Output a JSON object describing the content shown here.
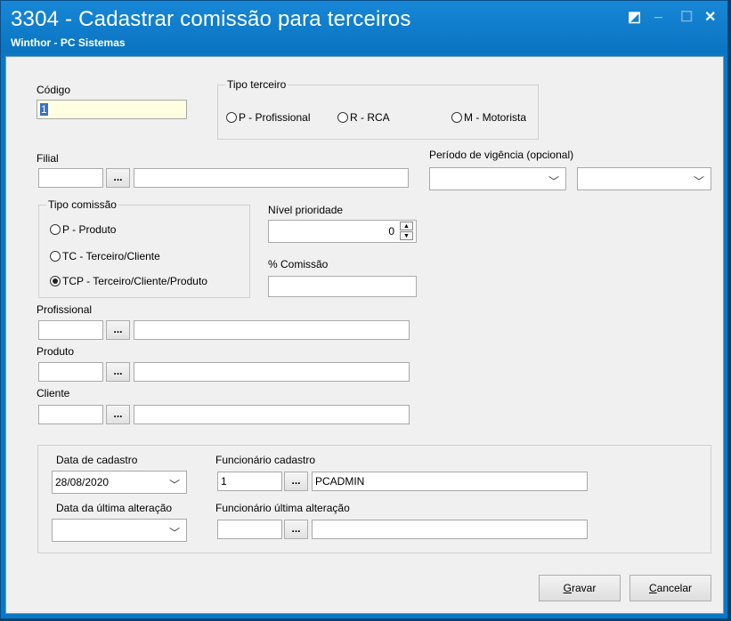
{
  "window": {
    "title": "3304 - Cadastrar comissão para terceiros",
    "subtitle": "Winthor - PC Sistemas",
    "controls": {
      "restore": "◩",
      "minimize": "_",
      "maximize": "☐",
      "close": "✕"
    }
  },
  "codigo": {
    "label": "Código",
    "value": "1"
  },
  "tipo_terceiro": {
    "title": "Tipo terceiro",
    "options": [
      "P - Profissional",
      "R - RCA",
      "M - Motorista"
    ]
  },
  "filial": {
    "label": "Filial",
    "code": "",
    "name": "",
    "button": "..."
  },
  "periodo": {
    "label": "Período de vigência (opcional)",
    "start": "",
    "end": ""
  },
  "tipo_comissao": {
    "title": "Tipo comissão",
    "options": [
      "P - Produto",
      "TC - Terceiro/Cliente",
      "TCP - Terceiro/Cliente/Produto"
    ],
    "selected": "TCP - Terceiro/Cliente/Produto"
  },
  "nivel_prioridade": {
    "label": "Nível prioridade",
    "value": "0"
  },
  "percent_comissao": {
    "label": "% Comissão",
    "value": ""
  },
  "profissional": {
    "label": "Profissional",
    "code": "",
    "name": "",
    "button": "..."
  },
  "produto": {
    "label": "Produto",
    "code": "",
    "name": "",
    "button": "..."
  },
  "cliente": {
    "label": "Cliente",
    "code": "",
    "name": "",
    "button": "..."
  },
  "audit": {
    "data_cadastro_label": "Data de cadastro",
    "data_cadastro": "28/08/2020",
    "func_cadastro_label": "Funcionário cadastro",
    "func_cadastro_code": "1",
    "func_cadastro_name": "PCADMIN",
    "data_alteracao_label": "Data da última alteração",
    "data_alteracao": "",
    "func_alteracao_label": "Funcionário última alteração",
    "func_alteracao_code": "",
    "func_alteracao_name": "",
    "button": "..."
  },
  "buttons": {
    "gravar": "Gravar",
    "cancelar": "Cancelar"
  },
  "colors": {
    "title_bar": "#0a78c4",
    "codigo_bg": "#ffffe1",
    "form_bg": "#f0f0f0"
  }
}
